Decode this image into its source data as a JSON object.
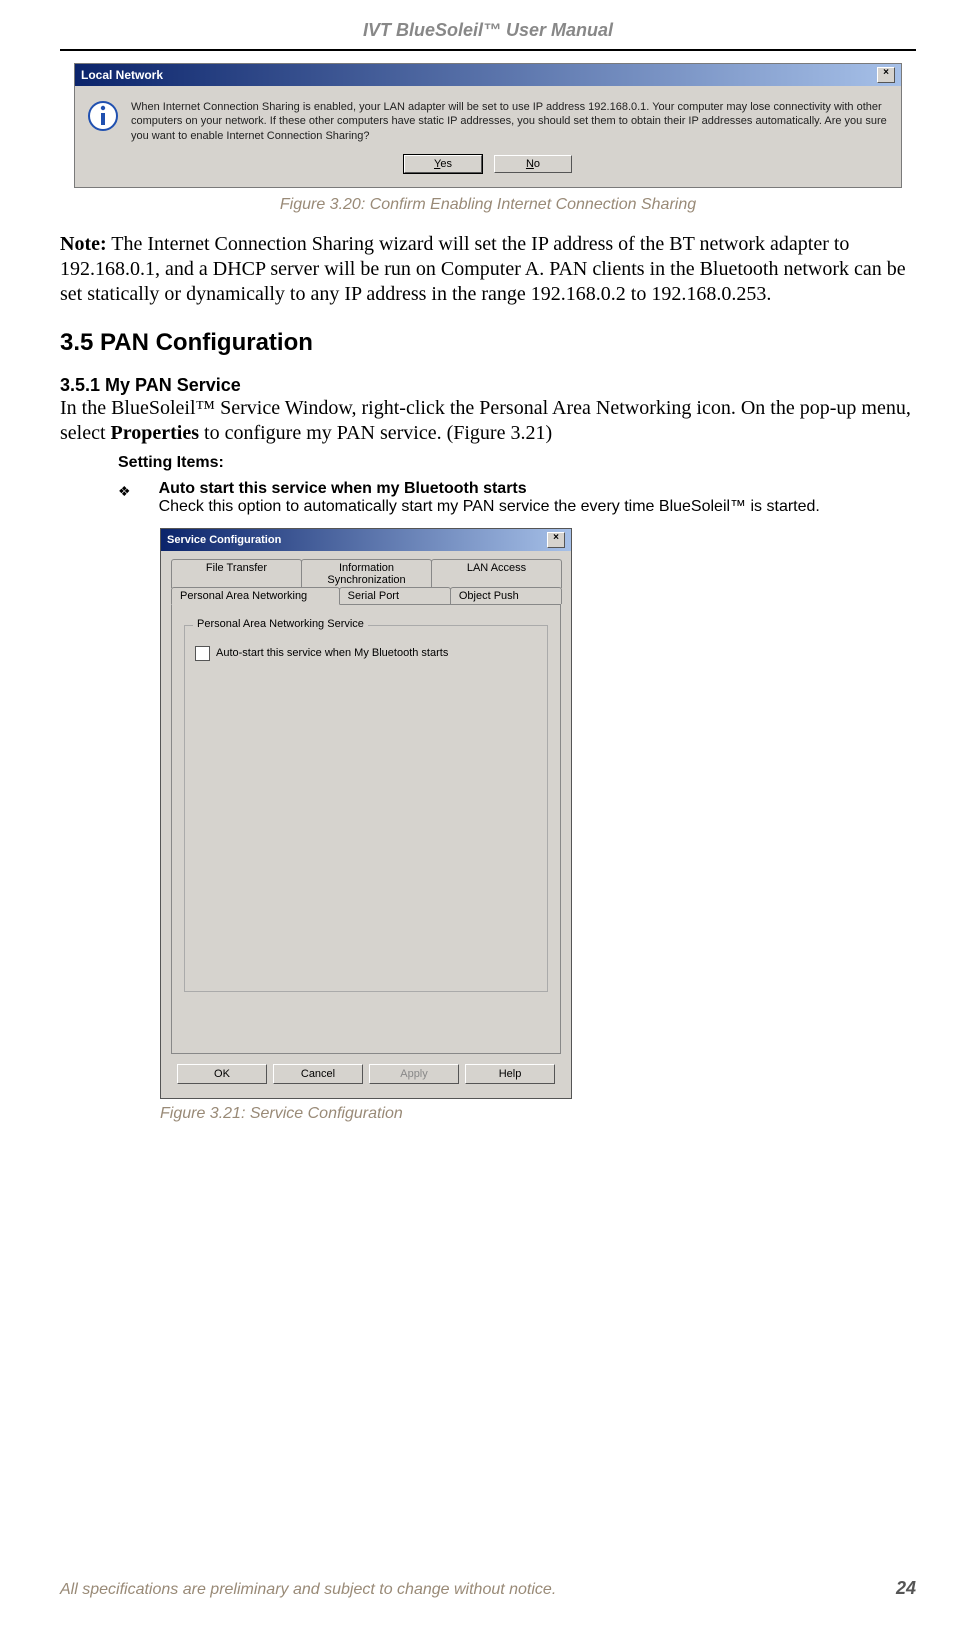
{
  "header": {
    "title": "IVT BlueSoleil™ User Manual"
  },
  "dialog1": {
    "title": "Local Network",
    "message": "When Internet Connection Sharing is enabled, your LAN adapter will be set to use IP address 192.168.0.1. Your computer may lose connectivity with other computers on your network. If these other computers have static IP addresses, you should set them to obtain their IP addresses automatically. Are you sure you want to enable Internet Connection Sharing?",
    "yes": "Yes",
    "no": "No"
  },
  "fig320": "Figure 3.20: Confirm Enabling Internet Connection Sharing",
  "note_label": "Note:",
  "note_text": " The Internet Connection Sharing wizard will set the IP address of the BT network adapter to 192.168.0.1, and a DHCP server will be run on Computer A. PAN clients in the Bluetooth network can be set statically or dynamically to any IP address in the range 192.168.0.2 to 192.168.0.253.",
  "sec35": "3.5  PAN Configuration",
  "sec351": "3.5.1 My PAN Service",
  "sec351_text_a": "In the BlueSoleil™ Service Window, right-click the Personal Area Networking icon. On the pop-up menu, select ",
  "sec351_text_b": "Properties",
  "sec351_text_c": " to configure my PAN service. (Figure 3.21)",
  "setting_items": "Setting Items:",
  "setting_bullet": "❖",
  "setting_item_title": "Auto start this service when my Bluetooth starts",
  "setting_item_desc": "Check this option to automatically start my PAN service the every time BlueSoleil™ is started.",
  "dialog2": {
    "title": "Service Configuration",
    "tabs_row1": [
      "File Transfer",
      "Information Synchronization",
      "LAN Access"
    ],
    "tabs_row2": [
      "Personal Area Networking",
      "Serial Port",
      "Object Push"
    ],
    "group_title": "Personal Area Networking Service",
    "checkbox_label": "Auto-start this service when My Bluetooth starts",
    "ok": "OK",
    "cancel": "Cancel",
    "apply": "Apply",
    "help": "Help"
  },
  "fig321": "Figure 3.21: Service Configuration",
  "footer": {
    "text": "All specifications are preliminary and subject to change without notice.",
    "page": "24"
  }
}
